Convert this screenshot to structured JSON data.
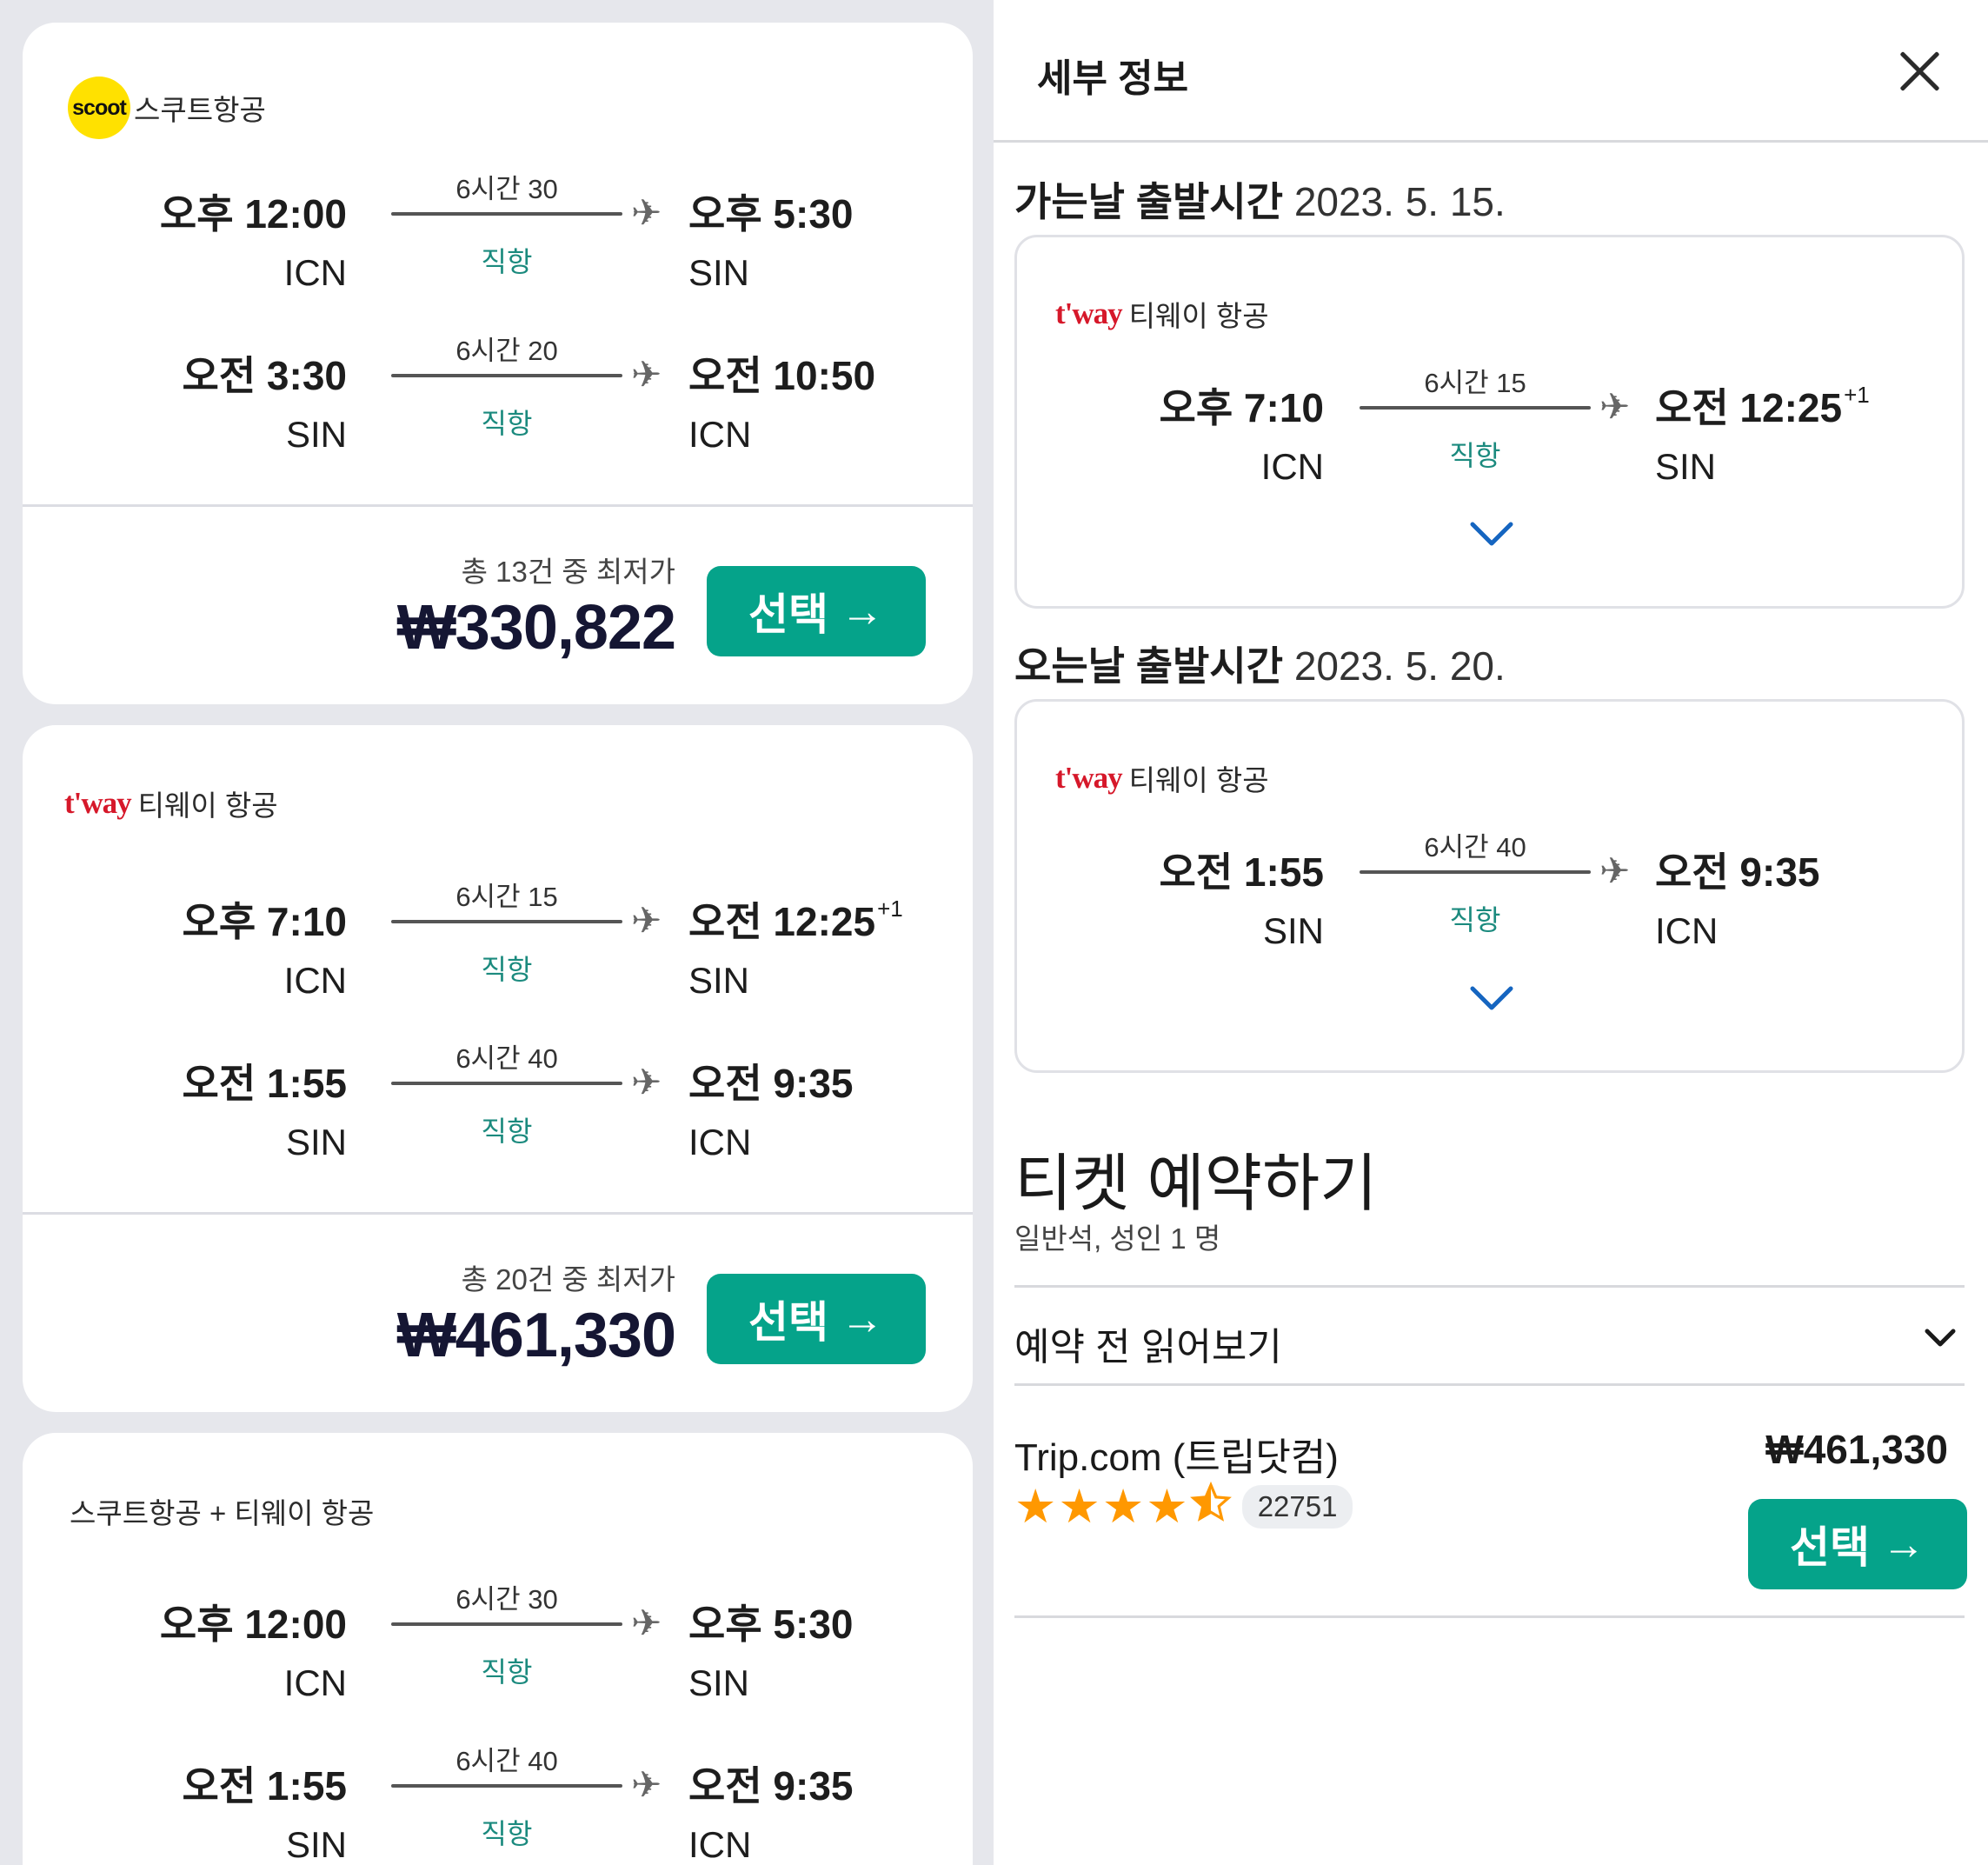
{
  "results": [
    {
      "airline": {
        "logo": "scoot",
        "logo_text": "scoot",
        "name": "스쿠트항공"
      },
      "legs": [
        {
          "dep_time": "오후 12:00",
          "dep_code": "ICN",
          "duration": "6시간 30",
          "stops": "직항",
          "arr_time": "오후 5:30",
          "arr_code": "SIN",
          "next_day": ""
        },
        {
          "dep_time": "오전 3:30",
          "dep_code": "SIN",
          "duration": "6시간 20",
          "stops": "직항",
          "arr_time": "오전 10:50",
          "arr_code": "ICN",
          "next_day": ""
        }
      ],
      "price_label": "총 13건 중 최저가",
      "price": "₩330,822",
      "select_label": "선택"
    },
    {
      "airline": {
        "logo": "tway",
        "logo_text": "t'way",
        "name": "티웨이 항공"
      },
      "legs": [
        {
          "dep_time": "오후 7:10",
          "dep_code": "ICN",
          "duration": "6시간 15",
          "stops": "직항",
          "arr_time": "오전 12:25",
          "arr_code": "SIN",
          "next_day": "+1"
        },
        {
          "dep_time": "오전 1:55",
          "dep_code": "SIN",
          "duration": "6시간 40",
          "stops": "직항",
          "arr_time": "오전 9:35",
          "arr_code": "ICN",
          "next_day": ""
        }
      ],
      "price_label": "총 20건 중 최저가",
      "price": "₩461,330",
      "select_label": "선택"
    },
    {
      "airline": {
        "logo": "",
        "logo_text": "",
        "name": "스쿠트항공 + 티웨이 항공"
      },
      "legs": [
        {
          "dep_time": "오후 12:00",
          "dep_code": "ICN",
          "duration": "6시간 30",
          "stops": "직항",
          "arr_time": "오후 5:30",
          "arr_code": "SIN",
          "next_day": ""
        },
        {
          "dep_time": "오전 1:55",
          "dep_code": "SIN",
          "duration": "6시간 40",
          "stops": "직항",
          "arr_time": "오전 9:35",
          "arr_code": "ICN",
          "next_day": ""
        }
      ]
    }
  ],
  "details": {
    "title": "세부 정보",
    "outbound": {
      "label": "가는날 출발시간",
      "date": "2023. 5. 15.",
      "airline_logo_text": "t'way",
      "airline_name": "티웨이 항공",
      "dep_time": "오후 7:10",
      "dep_code": "ICN",
      "duration": "6시간 15",
      "stops": "직항",
      "arr_time": "오전 12:25",
      "arr_code": "SIN",
      "next_day": "+1"
    },
    "inbound": {
      "label": "오는날 출발시간",
      "date": "2023. 5. 20.",
      "airline_logo_text": "t'way",
      "airline_name": "티웨이 항공",
      "dep_time": "오전 1:55",
      "dep_code": "SIN",
      "duration": "6시간 40",
      "stops": "직항",
      "arr_time": "오전 9:35",
      "arr_code": "ICN",
      "next_day": ""
    },
    "booking": {
      "title": "티켓 예약하기",
      "subtitle": "일반석, 성인 1 명",
      "read_before": "예약 전 읽어보기",
      "provider": {
        "name": "Trip.com (트립닷컴)",
        "price": "₩461,330",
        "rating": 4.5,
        "review_count": "22751",
        "select_label": "선택"
      }
    }
  },
  "colors": {
    "accent": "#05a38a",
    "stops_text": "#1b8a7e",
    "price_text": "#151633",
    "scoot_yellow": "#ffe100",
    "tway_red": "#d6182a",
    "star": "#ff9800",
    "chevron_blue": "#1565c0"
  }
}
